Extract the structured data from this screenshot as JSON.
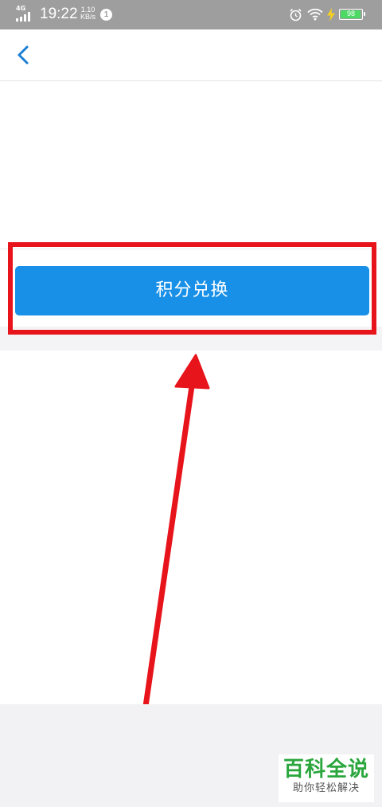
{
  "status_bar": {
    "network_type": "4G",
    "time": "19:22",
    "speed_value": "1.10",
    "speed_unit": "KB/s",
    "notification_count": "1",
    "battery_level": "98",
    "battery_fraction": 0.98,
    "icons": [
      "signal-icon",
      "alarm-icon",
      "wifi-icon",
      "charging-icon",
      "battery-icon"
    ]
  },
  "nav": {
    "back_icon": "chevron-left-icon"
  },
  "main": {
    "exchange_button_label": "积分兑换"
  },
  "watermark": {
    "brand": "百科全说",
    "slogan": "助你轻松解决"
  },
  "colors": {
    "accent": "#1890e8",
    "status_bar": "#9e9e9e",
    "highlight": "#e8141c",
    "battery": "#4cd964",
    "watermark_green": "#2aa63c"
  }
}
